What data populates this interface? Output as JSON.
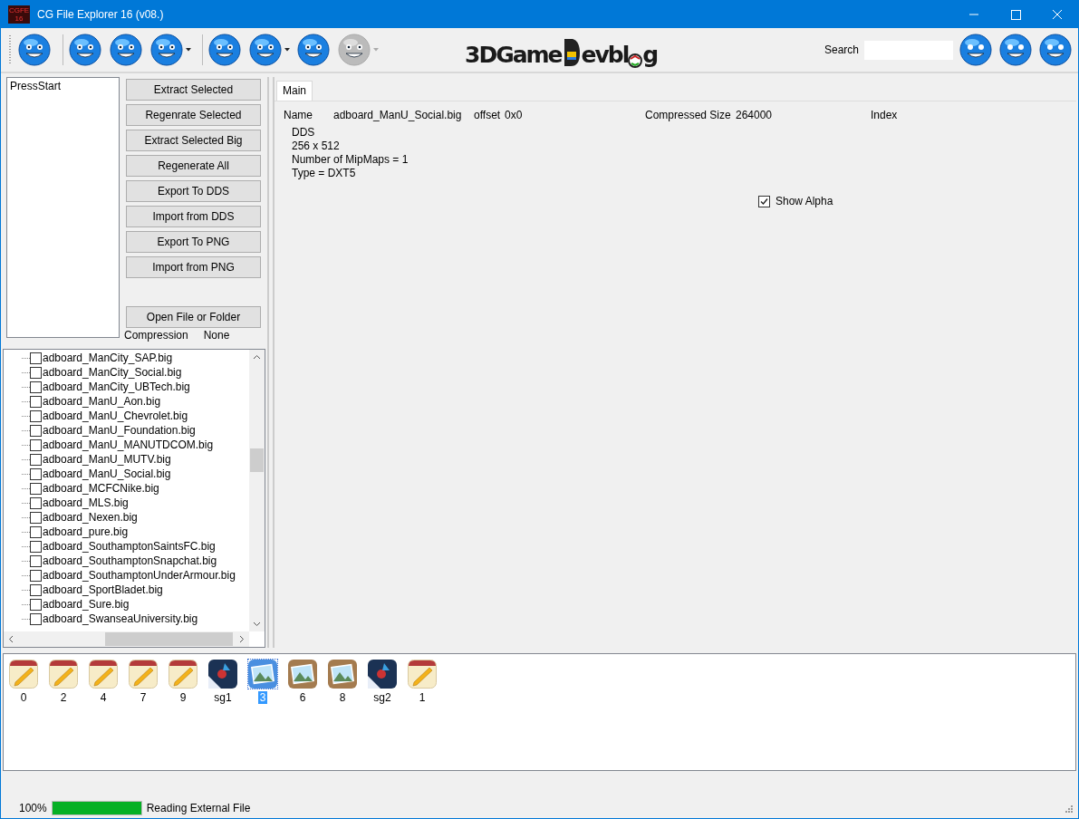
{
  "window": {
    "title": "CG File Explorer 16 (v08.)",
    "app_icon_text": "CGFE 16"
  },
  "toolbar": {
    "items": [
      {
        "kind": "button",
        "disabled": false
      },
      {
        "kind": "separator"
      },
      {
        "kind": "button",
        "disabled": false
      },
      {
        "kind": "button",
        "disabled": false
      },
      {
        "kind": "dropdown",
        "disabled": false
      },
      {
        "kind": "separator"
      },
      {
        "kind": "button",
        "disabled": false
      },
      {
        "kind": "dropdown",
        "disabled": false
      },
      {
        "kind": "button",
        "disabled": false
      },
      {
        "kind": "dropdown",
        "disabled": true
      }
    ],
    "logo": [
      "3DGame",
      "evbl",
      "g"
    ],
    "search_label": "Search"
  },
  "left_panel": {
    "list": [
      "PressStart"
    ],
    "buttons": [
      "Extract Selected",
      "Regenrate Selected",
      "Extract Selected Big",
      "Regenerate All",
      "Export To DDS",
      "Import from DDS",
      "Export To PNG",
      "Import from PNG"
    ],
    "open_button": "Open File or Folder",
    "compression_label": "Compression",
    "compression_value": "None"
  },
  "tree": {
    "items": [
      {
        "label": "adboard_ManCity_SAP.big",
        "checked": false
      },
      {
        "label": "adboard_ManCity_Social.big",
        "checked": false
      },
      {
        "label": "adboard_ManCity_UBTech.big",
        "checked": false
      },
      {
        "label": "adboard_ManU_Aon.big",
        "checked": false
      },
      {
        "label": "adboard_ManU_Chevrolet.big",
        "checked": false
      },
      {
        "label": "adboard_ManU_Foundation.big",
        "checked": false
      },
      {
        "label": "adboard_ManU_MANUTDCOM.big",
        "checked": false
      },
      {
        "label": "adboard_ManU_MUTV.big",
        "checked": false
      },
      {
        "label": "adboard_ManU_Social.big",
        "checked": false
      },
      {
        "label": "adboard_MCFCNike.big",
        "checked": false
      },
      {
        "label": "adboard_MLS.big",
        "checked": false
      },
      {
        "label": "adboard_Nexen.big",
        "checked": false
      },
      {
        "label": "adboard_pure.big",
        "checked": false
      },
      {
        "label": "adboard_SouthamptonSaintsFC.big",
        "checked": false
      },
      {
        "label": "adboard_SouthamptonSnapchat.big",
        "checked": false
      },
      {
        "label": "adboard_SouthamptonUnderArmour.big",
        "checked": false
      },
      {
        "label": "adboard_SportBladet.big",
        "checked": false
      },
      {
        "label": "adboard_Sure.big",
        "checked": false
      },
      {
        "label": "adboard_SwanseaUniversity.big",
        "checked": false
      }
    ]
  },
  "main": {
    "tabs": [
      {
        "label": "Main",
        "selected": true
      }
    ],
    "name_label": "Name",
    "name_value": "adboard_ManU_Social.big",
    "offset_label": "offset",
    "offset_value": "0x0",
    "size_label": "Compressed Size",
    "size_value": "264000",
    "index_label": "Index",
    "info": [
      "DDS",
      "256 x 512",
      "Number of MipMaps = 1",
      "Type = DXT5"
    ],
    "show_alpha": {
      "label": "Show Alpha",
      "checked": true
    }
  },
  "thumbnails": [
    {
      "label": "0",
      "kind": "notepad",
      "selected": false
    },
    {
      "label": "2",
      "kind": "notepad",
      "selected": false
    },
    {
      "label": "4",
      "kind": "notepad",
      "selected": false
    },
    {
      "label": "7",
      "kind": "notepad",
      "selected": false
    },
    {
      "label": "9",
      "kind": "notepad",
      "selected": false
    },
    {
      "label": "sg1",
      "kind": "game",
      "selected": false
    },
    {
      "label": "3",
      "kind": "photo",
      "selected": true
    },
    {
      "label": "6",
      "kind": "photo",
      "selected": false
    },
    {
      "label": "8",
      "kind": "photo",
      "selected": false
    },
    {
      "label": "sg2",
      "kind": "game",
      "selected": false
    },
    {
      "label": "1",
      "kind": "notepad",
      "selected": false
    }
  ],
  "status_bar": {
    "percent": "100%",
    "level": 1,
    "message": "Reading External File"
  }
}
